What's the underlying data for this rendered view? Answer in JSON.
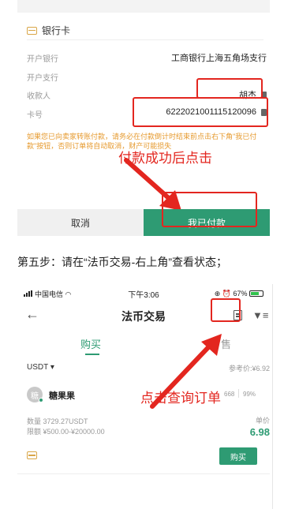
{
  "payment_card": {
    "section_title": "银行卡",
    "fields": [
      {
        "label": "开户银行",
        "value": "工商银行上海五角场支行"
      },
      {
        "label": "开户支行",
        "value": ""
      },
      {
        "label": "收款人",
        "value": "胡杰"
      },
      {
        "label": "卡号",
        "value": "6222021001115120096"
      }
    ],
    "warning": "如果您已向卖家转账付款，请务必在付款倒计时结束前点击右下角\"我已付款\"按钮，否则订单将自动取消，财产可能损失",
    "buttons": {
      "cancel": "取消",
      "paid": "我已付款"
    }
  },
  "annotations": {
    "after_payment": "付款成功后点击",
    "query_order": "点击查询订单"
  },
  "step_text": "第五步：请在“法币交易-右上角”查看状态；",
  "phone": {
    "status_bar": {
      "carrier": "中国电信",
      "time": "下午3:06",
      "battery": "67%"
    },
    "nav": {
      "back_icon": "back-arrow-icon",
      "title": "法币交易",
      "order_icon": "order-list-icon",
      "filter_icon": "filter-icon"
    },
    "tabs": {
      "buy": "购买",
      "sell": "售"
    },
    "coin": "USDT ▾",
    "reference_price": "参考价:¥6.92",
    "merchant": {
      "avatar_letter": "糖",
      "name": "糖果果",
      "stat_orders": "668",
      "stat_rate": "99%",
      "quantity": "数量 3729.27USDT",
      "limit": "限额 ¥500.00-¥20000.00",
      "unit_price_label": "单价",
      "unit_price": "6.98",
      "buy_button": "购买"
    }
  },
  "colors": {
    "accent": "#2e9b73",
    "annotation": "#e3261f",
    "warning": "#e69a2e"
  }
}
